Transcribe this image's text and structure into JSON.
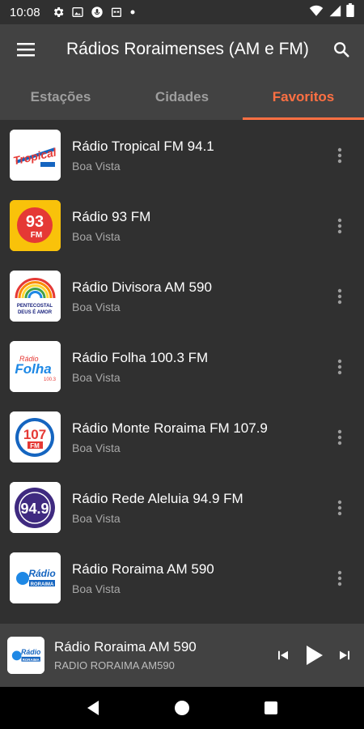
{
  "status": {
    "time": "10:08"
  },
  "appbar": {
    "title": "Rádios Roraimenses (AM e FM)"
  },
  "tabs": [
    {
      "label": "Estações"
    },
    {
      "label": "Cidades"
    },
    {
      "label": "Favoritos",
      "active": true
    }
  ],
  "stations": [
    {
      "name": "Rádio Tropical FM 94.1",
      "city": "Boa Vista",
      "logo_text": "Tropical"
    },
    {
      "name": "Rádio 93 FM",
      "city": "Boa Vista",
      "logo_text": "93 FM"
    },
    {
      "name": "Rádio Divisora AM 590",
      "city": "Boa Vista",
      "logo_text": "PENTECOSTAL DEUS É AMOR"
    },
    {
      "name": "Rádio Folha 100.3 FM",
      "city": "Boa Vista",
      "logo_text": "Folha"
    },
    {
      "name": "Rádio Monte Roraima FM 107.9",
      "city": "Boa Vista",
      "logo_text": "107 FM"
    },
    {
      "name": "Rádio Rede Aleluia 94.9 FM",
      "city": "Boa Vista",
      "logo_text": "94.9"
    },
    {
      "name": "Rádio Roraima AM 590",
      "city": "Boa Vista",
      "logo_text": "Rádio RORAIMA"
    }
  ],
  "player": {
    "title": "Rádio Roraima AM 590",
    "subtitle": "RADIO RORAIMA AM590"
  },
  "colors": {
    "accent": "#ff7043",
    "appbar": "#424242",
    "background": "#303030"
  }
}
